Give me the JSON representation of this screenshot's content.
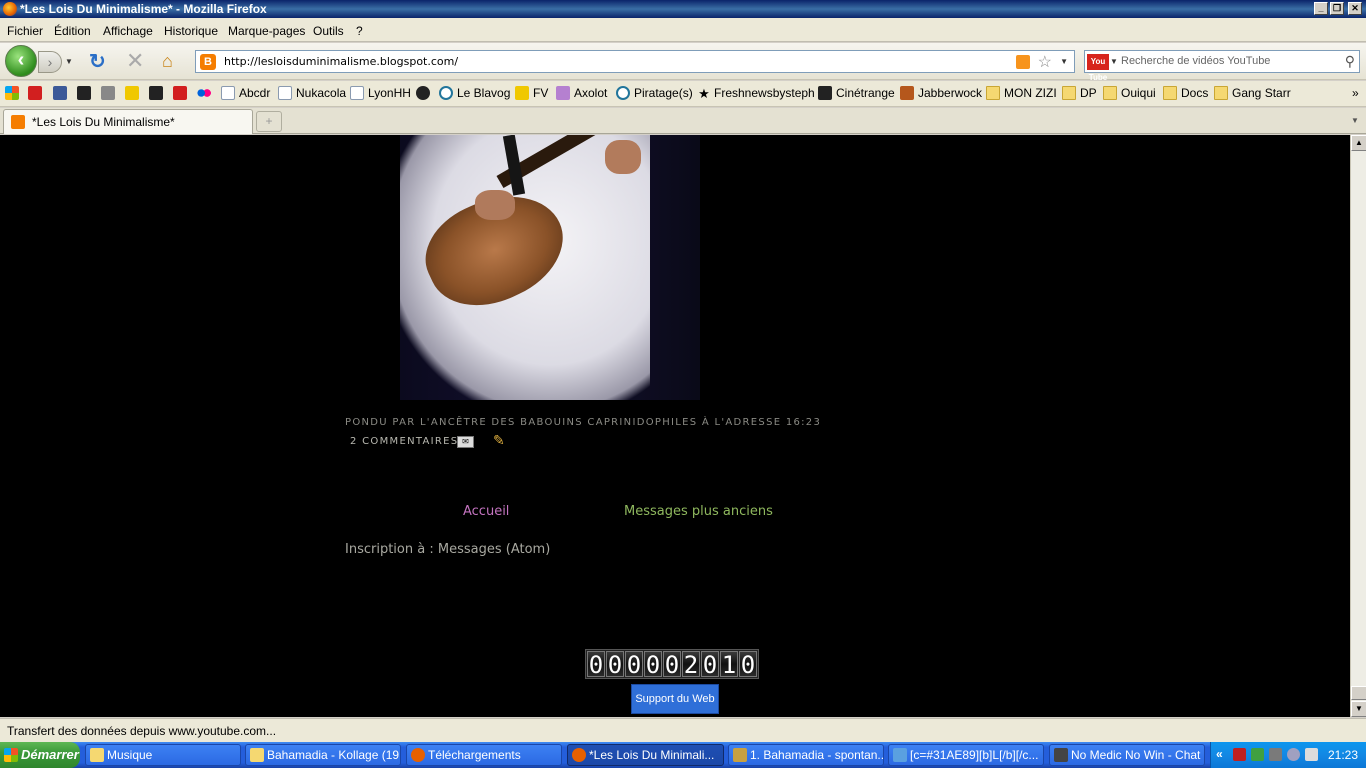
{
  "window": {
    "title": "*Les Lois Du Minimalisme* - Mozilla Firefox",
    "minimize": "_",
    "maximize": "❐",
    "close": "✕"
  },
  "menu": [
    "Fichier",
    "Édition",
    "Affichage",
    "Historique",
    "Marque-pages",
    "Outils",
    "?"
  ],
  "nav": {
    "url": "http://lesloisduminimalisme.blogspot.com/",
    "search_placeholder": "Recherche de vidéos YouTube",
    "search_engine_label": "You Tube"
  },
  "bookmarks": [
    {
      "label": "",
      "icon": "windows-icon"
    },
    {
      "label": "",
      "icon": "red-icon"
    },
    {
      "label": "",
      "icon": "facebook-icon"
    },
    {
      "label": "",
      "icon": "discogs-icon"
    },
    {
      "label": "",
      "icon": "skull-icon"
    },
    {
      "label": "",
      "icon": "eye-icon"
    },
    {
      "label": "",
      "icon": "mask-icon"
    },
    {
      "label": "",
      "icon": "red-c-icon"
    },
    {
      "label": "",
      "icon": "flickr-icon"
    },
    {
      "label": "Abcdr",
      "icon": "page-icon"
    },
    {
      "label": "Nukacola",
      "icon": "page-icon"
    },
    {
      "label": "LyonHH",
      "icon": "page-icon"
    },
    {
      "label": "",
      "icon": "vinyl-icon"
    },
    {
      "label": "Le Blavog",
      "icon": "wordpress-icon"
    },
    {
      "label": "FV",
      "icon": "fv-icon"
    },
    {
      "label": "Axolot",
      "icon": "axolot-icon"
    },
    {
      "label": "Piratage(s)",
      "icon": "wordpress-icon"
    },
    {
      "label": "Freshnewsbysteph",
      "icon": "star-icon"
    },
    {
      "label": "Cinétrange",
      "icon": "cinetrange-icon"
    },
    {
      "label": "Jabberwock",
      "icon": "jabberwock-icon"
    },
    {
      "label": "MON ZIZI",
      "icon": "folder-icon"
    },
    {
      "label": "DP",
      "icon": "folder-icon"
    },
    {
      "label": "Ouiqui",
      "icon": "folder-icon"
    },
    {
      "label": "Docs",
      "icon": "folder-icon"
    },
    {
      "label": "Gang Starr",
      "icon": "folder-icon"
    }
  ],
  "bookmarks_overflow": "»",
  "tabs": [
    {
      "label": "*Les Lois Du Minimalisme*",
      "active": true
    }
  ],
  "new_tab": "+",
  "post": {
    "footer": "PONDU PAR L'ANCÊTRE DES BABOUINS CAPRINIDOPHILES À L'ADRESSE 16:23",
    "comments": "2 COMMENTAIRES"
  },
  "blog_nav": {
    "home": "Accueil",
    "older": "Messages plus anciens"
  },
  "subscribe": {
    "label": "Inscription à : ",
    "link": "Messages (Atom)"
  },
  "counter_digits": [
    "0",
    "0",
    "0",
    "0",
    "0",
    "2",
    "0",
    "1",
    "0"
  ],
  "support_button": "Support du Web",
  "status": "Transfert des données depuis www.youtube.com...",
  "taskbar": {
    "start": "Démarrer",
    "tasks": [
      {
        "label": "Musique",
        "icon": "folder-icon",
        "active": false
      },
      {
        "label": "Bahamadia - Kollage (19...",
        "icon": "folder-icon",
        "active": false
      },
      {
        "label": "Téléchargements",
        "icon": "firefox-icon",
        "active": false
      },
      {
        "label": "*Les Lois Du Minimali...",
        "icon": "firefox-icon",
        "active": true
      },
      {
        "label": "1. Bahamadia - spontan...",
        "icon": "winamp-icon",
        "active": false
      },
      {
        "label": "[c=#31AE89][b]L[/b][/c...",
        "icon": "messenger-icon",
        "active": false
      },
      {
        "label": "No Medic No Win - Chat",
        "icon": "steam-icon",
        "active": false
      }
    ],
    "tray_chevron": "«",
    "clock": "21:23"
  }
}
